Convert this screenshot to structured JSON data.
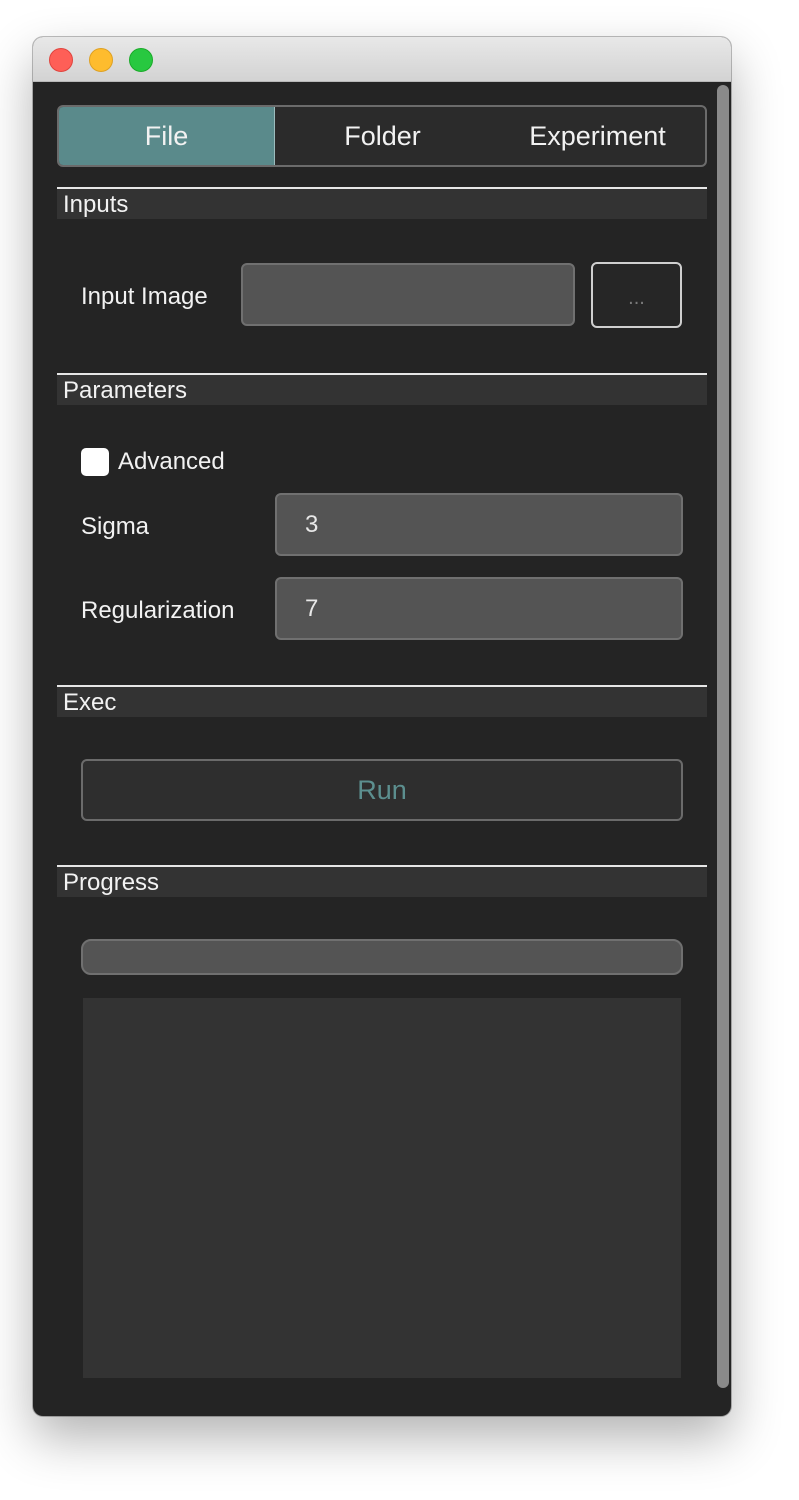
{
  "tabs": [
    {
      "label": "File",
      "active": true
    },
    {
      "label": "Folder",
      "active": false
    },
    {
      "label": "Experiment",
      "active": false
    }
  ],
  "sections": {
    "inputs": {
      "title": "Inputs",
      "input_image_label": "Input Image",
      "input_image_value": "",
      "browse_label": "..."
    },
    "parameters": {
      "title": "Parameters",
      "advanced_label": "Advanced",
      "advanced_checked": false,
      "sigma_label": "Sigma",
      "sigma_value": "3",
      "regularization_label": "Regularization",
      "regularization_value": "7"
    },
    "exec": {
      "title": "Exec",
      "run_label": "Run"
    },
    "progress": {
      "title": "Progress",
      "progress_percent": 0,
      "log_text": ""
    }
  },
  "colors": {
    "accent": "#5a8a8b",
    "window_bg": "#242424",
    "field_bg": "#545454",
    "run_text": "#5c8f8f"
  }
}
